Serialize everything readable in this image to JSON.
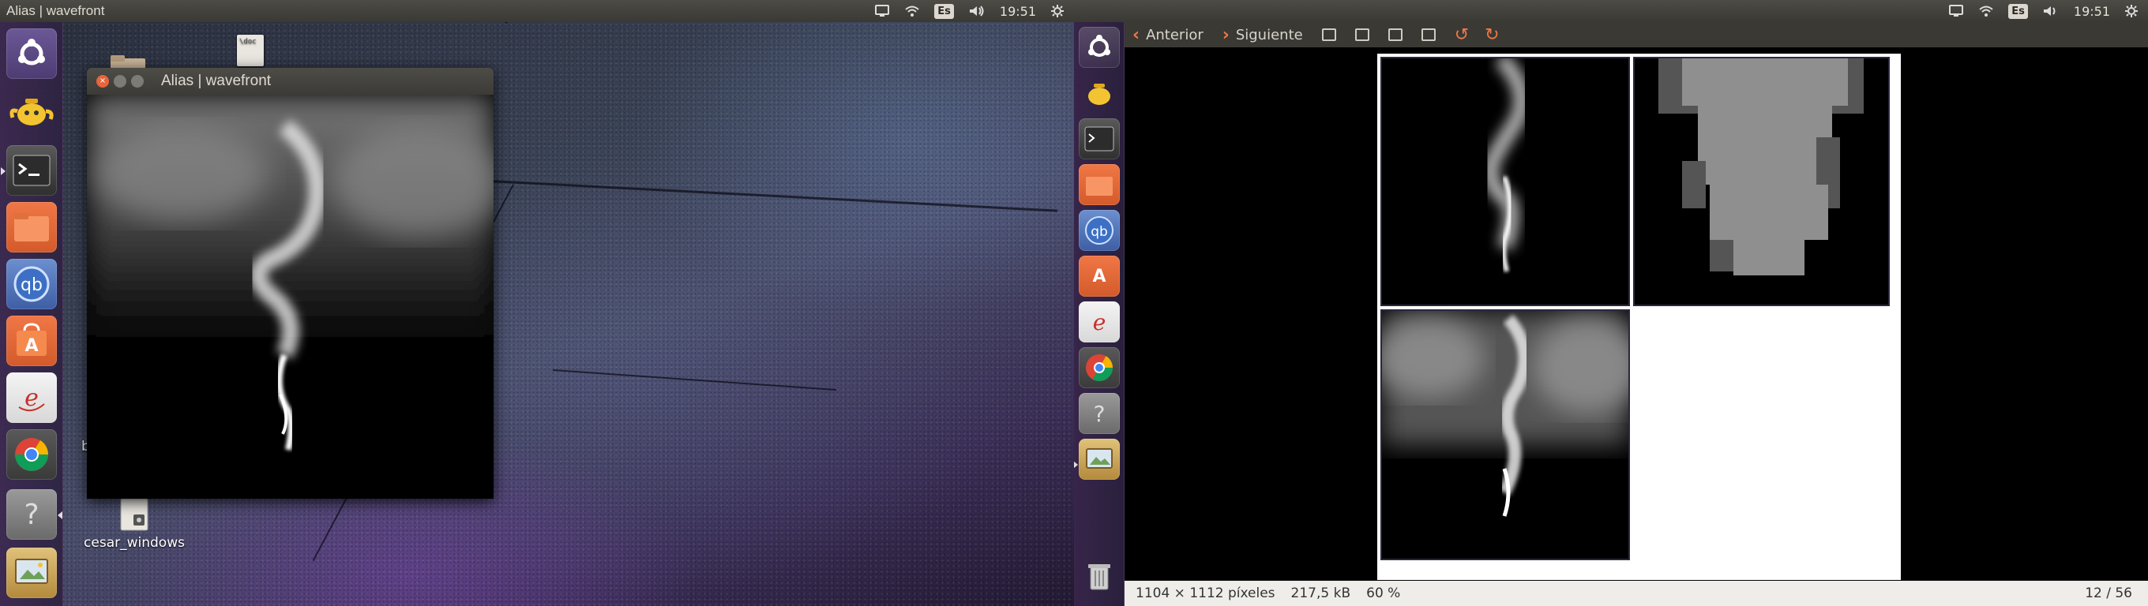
{
  "left_screen": {
    "panel": {
      "title": "Alias | wavefront",
      "keyboard_layout": "Es",
      "time": "19:51"
    },
    "window": {
      "title": "Alias | wavefront"
    },
    "desktop_icons": [
      {
        "label": "cesar_windows"
      },
      {
        "label": "b"
      }
    ]
  },
  "right_screen": {
    "panel": {
      "keyboard_layout": "Es",
      "time": "19:51"
    },
    "toolbar": {
      "prev_label": "Anterior",
      "next_label": "Siguiente"
    },
    "status": {
      "dimensions": "1104 × 1112 píxeles",
      "size": "217,5 kB",
      "zoom": "60 %",
      "pager": "12 / 56"
    }
  },
  "launcher_items": [
    {
      "icon": "ubuntu-dash-icon"
    },
    {
      "icon": "teapot-icon"
    },
    {
      "icon": "terminal-icon"
    },
    {
      "icon": "files-icon"
    },
    {
      "icon": "qbittorrent-icon"
    },
    {
      "icon": "software-center-icon"
    },
    {
      "icon": "emacs-icon"
    },
    {
      "icon": "chrome-icon"
    },
    {
      "icon": "help-icon"
    },
    {
      "icon": "image-viewer-icon"
    }
  ],
  "colors": {
    "panel": "#3c3b37",
    "accent_orange": "#f07746",
    "launcher": "#3a2d4f"
  }
}
